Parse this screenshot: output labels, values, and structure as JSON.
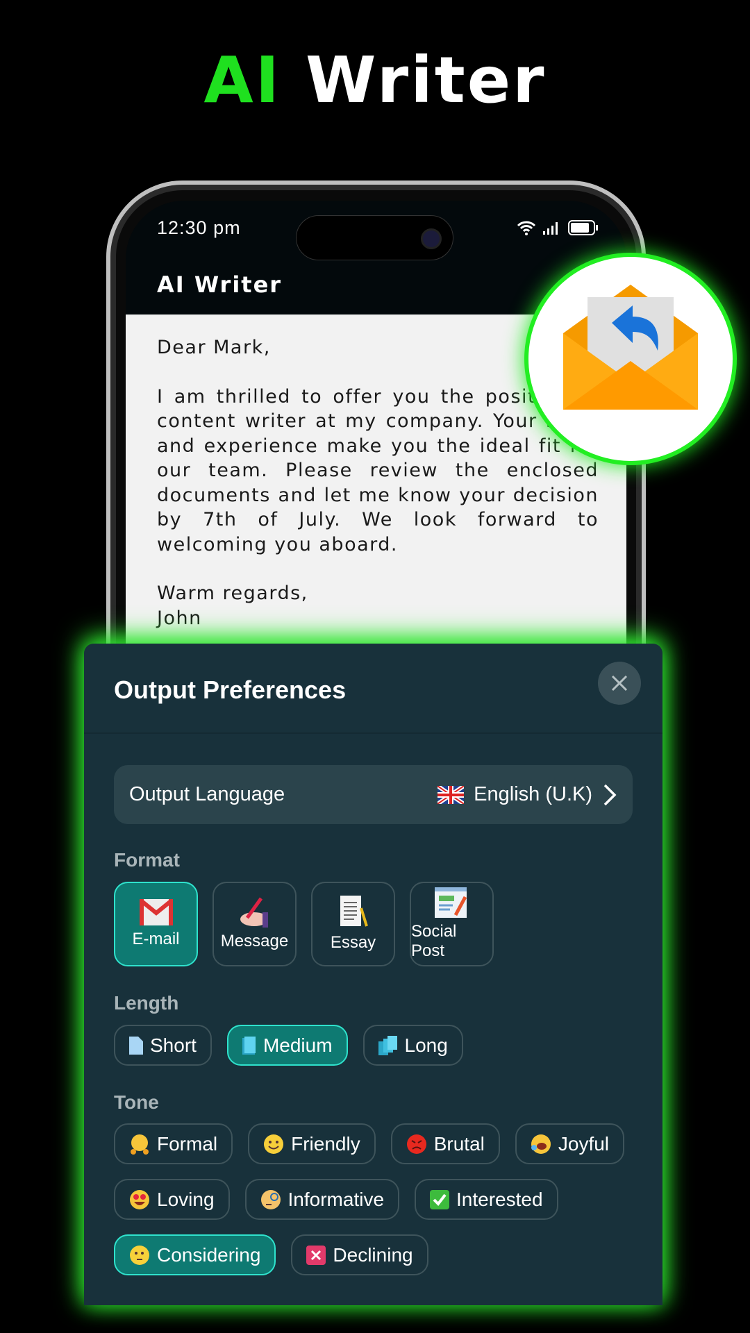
{
  "hero": {
    "accent": "AI",
    "rest": "Writer"
  },
  "status": {
    "time": "12:30 pm"
  },
  "app": {
    "title": "AI Writer"
  },
  "letter": {
    "greeting": "Dear Mark,",
    "body": "I am thrilled to offer you the position of content writer at my company. Your skills and experience make you the ideal fit for our team. Please review the enclosed documents and let me know your decision by 7th of July. We look forward to welcoming you aboard.",
    "closing": "Warm regards,",
    "signature": "John"
  },
  "panel": {
    "title": "Output Preferences",
    "language": {
      "label": "Output Language",
      "value": "English (U.K)",
      "flag": "uk-flag"
    },
    "format": {
      "label": "Format",
      "items": [
        {
          "label": "E-mail",
          "icon": "gmail-icon",
          "selected": true
        },
        {
          "label": "Message",
          "icon": "writing-hand-icon"
        },
        {
          "label": "Essay",
          "icon": "document-icon"
        },
        {
          "label": "Social Post",
          "icon": "social-post-icon"
        }
      ]
    },
    "length": {
      "label": "Length",
      "items": [
        {
          "label": "Short",
          "selected": false
        },
        {
          "label": "Medium",
          "selected": true
        },
        {
          "label": "Long",
          "selected": false
        }
      ]
    },
    "tone": {
      "label": "Tone",
      "items": [
        {
          "label": "Formal",
          "icon": "hugging-face"
        },
        {
          "label": "Friendly",
          "icon": "smiley"
        },
        {
          "label": "Brutal",
          "icon": "angry-face"
        },
        {
          "label": "Joyful",
          "icon": "laughing-face"
        },
        {
          "label": "Loving",
          "icon": "heart-eyes"
        },
        {
          "label": "Informative",
          "icon": "monocle-face"
        },
        {
          "label": "Interested",
          "icon": "check-mark"
        },
        {
          "label": "Considering",
          "icon": "thinking-face",
          "selected": true
        },
        {
          "label": "Declining",
          "icon": "cross-mark"
        }
      ]
    }
  },
  "colors": {
    "accent_green": "#1fe01f",
    "panel_bg": "#18313b",
    "selected": "#0e7a72",
    "selected_border": "#2fe2cc"
  }
}
